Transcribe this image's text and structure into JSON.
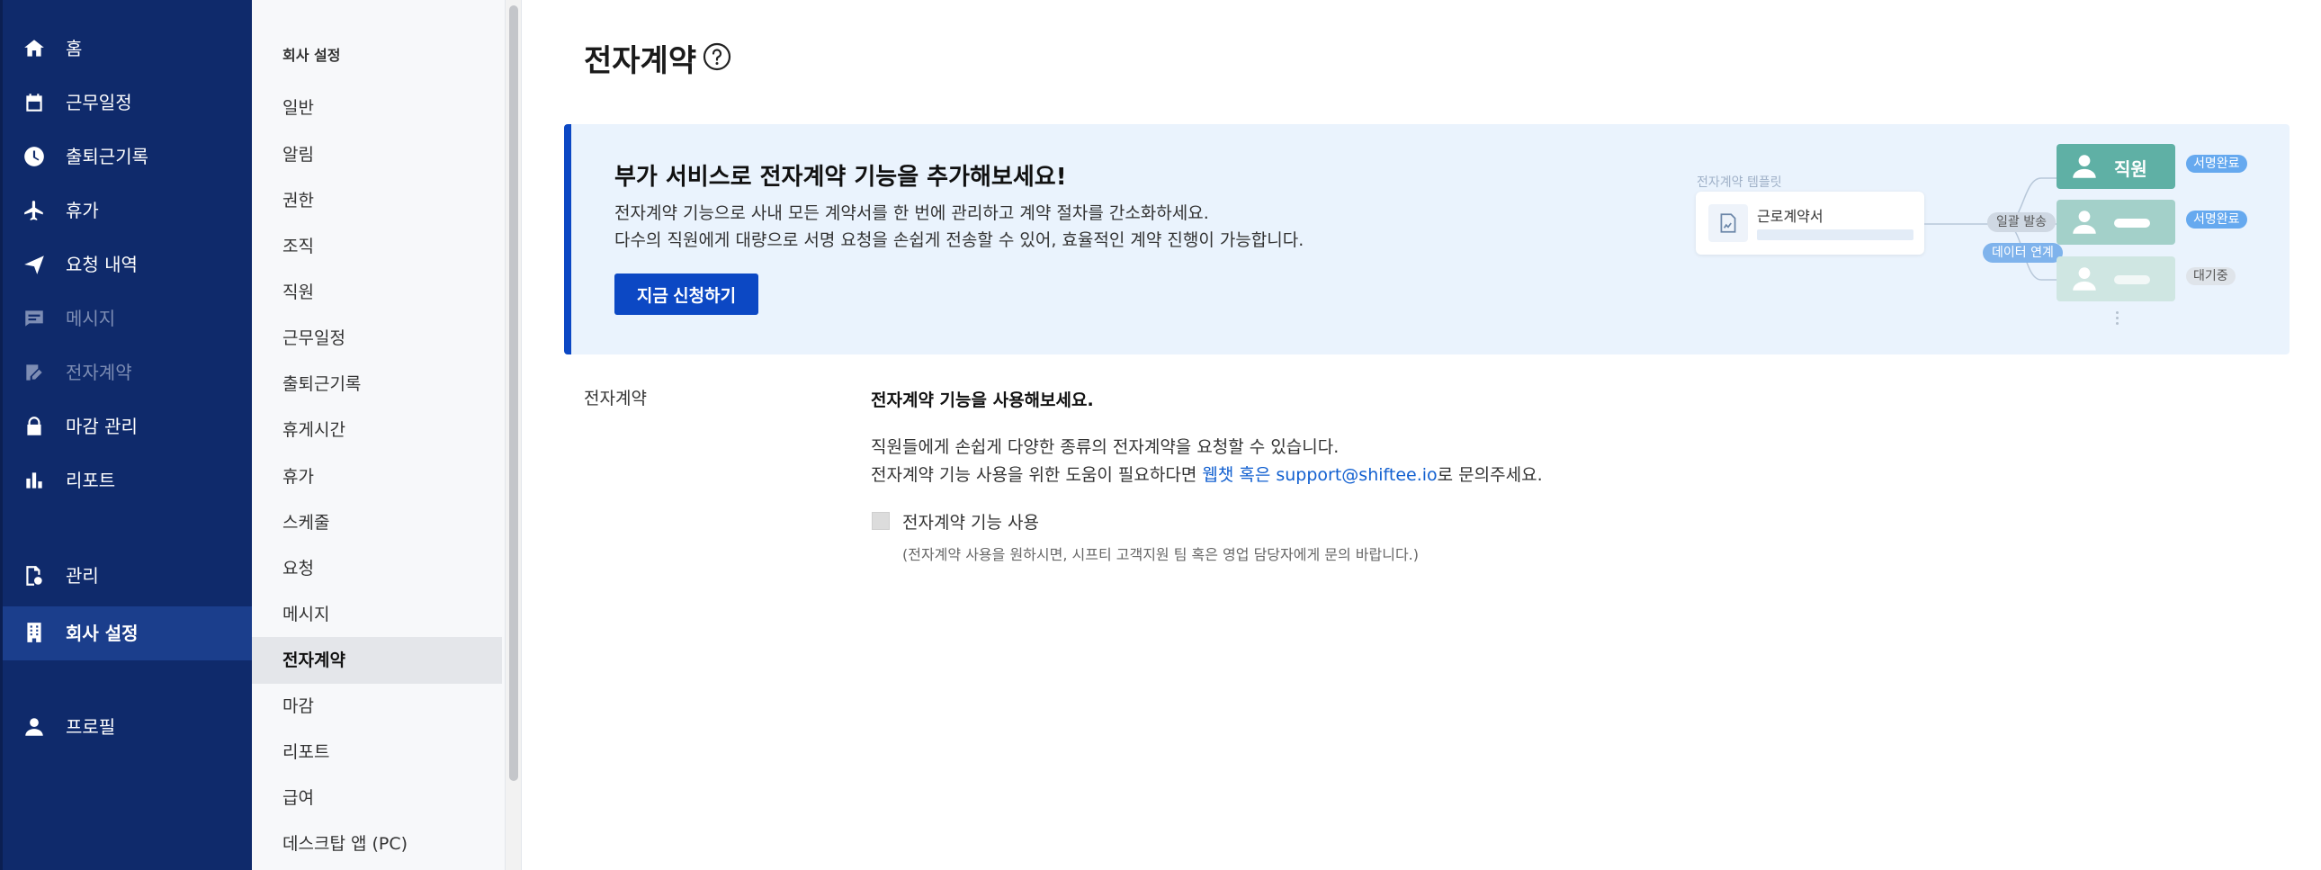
{
  "sidebar": {
    "items": [
      {
        "label": "홈",
        "icon": "home-icon"
      },
      {
        "label": "근무일정",
        "icon": "calendar-icon"
      },
      {
        "label": "출퇴근기록",
        "icon": "clock-icon"
      },
      {
        "label": "휴가",
        "icon": "airplane-icon"
      },
      {
        "label": "요청 내역",
        "icon": "send-icon"
      },
      {
        "label": "메시지",
        "icon": "message-icon"
      },
      {
        "label": "전자계약",
        "icon": "sign-icon"
      },
      {
        "label": "마감 관리",
        "icon": "lock-icon"
      },
      {
        "label": "리포트",
        "icon": "bar-chart-icon"
      },
      {
        "label": "관리",
        "icon": "manage-icon"
      },
      {
        "label": "회사 설정",
        "icon": "building-icon"
      },
      {
        "label": "프로필",
        "icon": "person-icon"
      }
    ]
  },
  "submenu": {
    "heading": "회사 설정",
    "items": [
      "일반",
      "알림",
      "권한",
      "조직",
      "직원",
      "근무일정",
      "출퇴근기록",
      "휴게시간",
      "휴가",
      "스케줄",
      "요청",
      "메시지",
      "전자계약",
      "마감",
      "리포트",
      "급여",
      "데스크탑 앱 (PC)"
    ],
    "active": "전자계약"
  },
  "main": {
    "title": "전자계약",
    "banner": {
      "title": "부가 서비스로 전자계약 기능을 추가해보세요!",
      "line1": "전자계약 기능으로 사내 모든 계약서를 한 번에 관리하고 계약 절차를 간소화하세요.",
      "line2": "다수의 직원에게 대량으로 서명 요청을 손쉽게 전송할 수 있어, 효율적인 계약 진행이 가능합니다.",
      "button": "지금 신청하기",
      "illustration": {
        "template_label": "전자계약 템플릿",
        "doc_name": "근로계약서",
        "send_pill": "일괄 발송",
        "data_pill": "데이터 연계",
        "employee_name": "직원",
        "status_done": "서명완료",
        "status_wait": "대기중"
      }
    },
    "section_label": "전자계약",
    "form": {
      "title": "전자계약 기능을 사용해보세요.",
      "desc1": "직원들에게 손쉽게 다양한 종류의 전자계약을 요청할 수 있습니다.",
      "desc2_pre": "전자계약 기능 사용을 위한 도움이 필요하다면 ",
      "desc2_link": "웹챗 혹은 support@shiftee.io",
      "desc2_post": "로 문의주세요.",
      "checkbox_label": "전자계약 기능 사용",
      "checkbox_checked": false,
      "checkbox_note": "(전자계약 사용을 원하시면, 시프티 고객지원 팀 혹은 영업 담당자에게 문의 바랍니다.)"
    }
  },
  "colors": {
    "sidebar_bg": "#0f2a6b",
    "accent": "#0c48c4",
    "link": "#1260d0",
    "banner_bg": "#eaf3fd"
  }
}
